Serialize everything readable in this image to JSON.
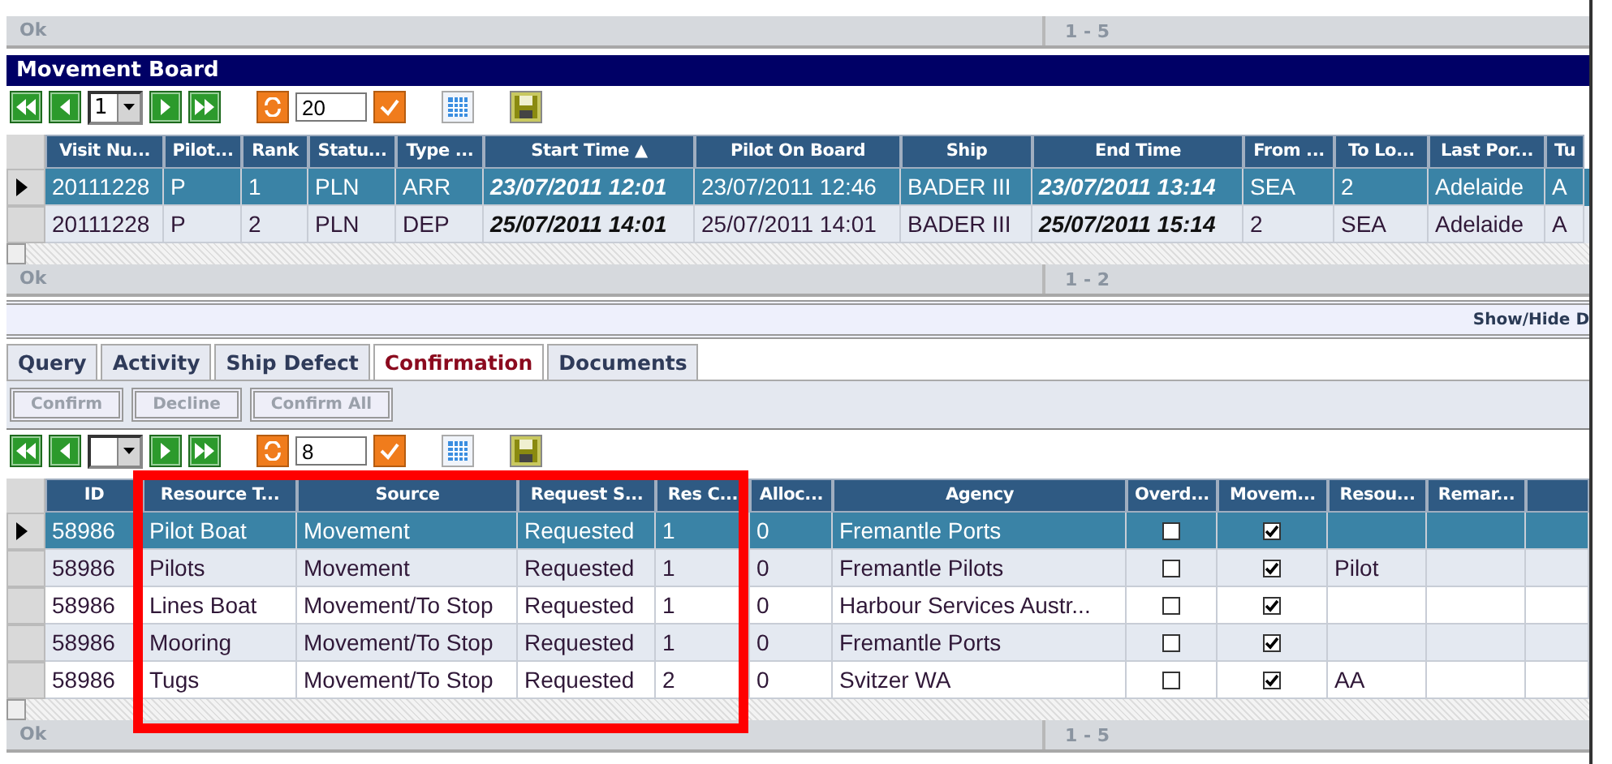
{
  "status_bar_top": {
    "message": "Ok",
    "range": "1 - 5"
  },
  "movement_board": {
    "title": "Movement Board",
    "pager": {
      "page": "1",
      "page_size": "20"
    },
    "columns": [
      {
        "label": "Visit Nu...",
        "emphasis": false
      },
      {
        "label": "Pilot...",
        "emphasis": false
      },
      {
        "label": "Rank",
        "emphasis": false
      },
      {
        "label": "Statu...",
        "emphasis": false
      },
      {
        "label": "Type ...",
        "emphasis": false
      },
      {
        "label": "Start Time ▲",
        "emphasis": true
      },
      {
        "label": "Pilot On Board",
        "emphasis": false
      },
      {
        "label": "Ship",
        "emphasis": false
      },
      {
        "label": "End Time",
        "emphasis": true
      },
      {
        "label": "From ...",
        "emphasis": false
      },
      {
        "label": "To Lo...",
        "emphasis": false
      },
      {
        "label": "Last Por...",
        "emphasis": false
      },
      {
        "label": "Tu",
        "emphasis": false
      }
    ],
    "rows": [
      {
        "selected": true,
        "cells": [
          "20111228",
          "P",
          "1",
          "PLN",
          "ARR",
          "23/07/2011 12:01",
          "23/07/2011 12:46",
          "BADER III",
          "23/07/2011 13:14",
          "SEA",
          "2",
          "Adelaide",
          "A"
        ]
      },
      {
        "selected": false,
        "cells": [
          "20111228",
          "P",
          "2",
          "PLN",
          "DEP",
          "25/07/2011 14:01",
          "25/07/2011 14:01",
          "BADER III",
          "25/07/2011 15:14",
          "2",
          "SEA",
          "Adelaide",
          "A"
        ]
      }
    ],
    "status_bar": {
      "message": "Ok",
      "range": "1 - 2"
    }
  },
  "details_bar": {
    "link": "Show/Hide D"
  },
  "tabs": [
    {
      "label": "Query",
      "selected": false
    },
    {
      "label": "Activity",
      "selected": false
    },
    {
      "label": "Ship Defect",
      "selected": false
    },
    {
      "label": "Confirmation",
      "selected": true
    },
    {
      "label": "Documents",
      "selected": false
    }
  ],
  "actions": [
    {
      "label": "Confirm",
      "disabled": true
    },
    {
      "label": "Decline",
      "disabled": true
    },
    {
      "label": "Confirm All",
      "disabled": true
    }
  ],
  "confirmation": {
    "pager": {
      "page_size": "8"
    },
    "columns": [
      {
        "label": "ID",
        "kind": "text"
      },
      {
        "label": "Resource T...",
        "kind": "text"
      },
      {
        "label": "Source",
        "kind": "text"
      },
      {
        "label": "Request S...",
        "kind": "text"
      },
      {
        "label": "Res C...",
        "kind": "text"
      },
      {
        "label": "Alloc...",
        "kind": "text"
      },
      {
        "label": "Agency",
        "kind": "text"
      },
      {
        "label": "Overd...",
        "kind": "check"
      },
      {
        "label": "Movem...",
        "kind": "check"
      },
      {
        "label": "Resou...",
        "kind": "text"
      },
      {
        "label": "Remar...",
        "kind": "text"
      }
    ],
    "rows": [
      {
        "selected": true,
        "cells": [
          "58986",
          "Pilot Boat",
          "Movement",
          "Requested",
          "1",
          "0",
          "Fremantle Ports",
          {
            "checked": false
          },
          {
            "checked": true
          },
          null,
          null
        ]
      },
      {
        "selected": false,
        "cells": [
          "58986",
          "Pilots",
          "Movement",
          "Requested",
          "1",
          "0",
          "Fremantle Pilots",
          {
            "checked": false
          },
          {
            "checked": true
          },
          "Pilot",
          null
        ]
      },
      {
        "selected": false,
        "cells": [
          "58986",
          "Lines Boat",
          "Movement/To Stop",
          "Requested",
          "1",
          "0",
          "Harbour Services Austr...",
          {
            "checked": false
          },
          {
            "checked": true
          },
          null,
          null
        ]
      },
      {
        "selected": false,
        "cells": [
          "58986",
          "Mooring",
          "Movement/To Stop",
          "Requested",
          "1",
          "0",
          "Fremantle Ports",
          {
            "checked": false
          },
          {
            "checked": true
          },
          null,
          null
        ]
      },
      {
        "selected": false,
        "cells": [
          "58986",
          "Tugs",
          "Movement/To Stop",
          "Requested",
          "2",
          "0",
          "Svitzer WA",
          {
            "checked": false
          },
          {
            "checked": true
          },
          "AA",
          null
        ]
      }
    ],
    "status_bar": {
      "message": "Ok",
      "range": "1 - 5"
    }
  },
  "highlight_frame": {
    "shown": true
  }
}
